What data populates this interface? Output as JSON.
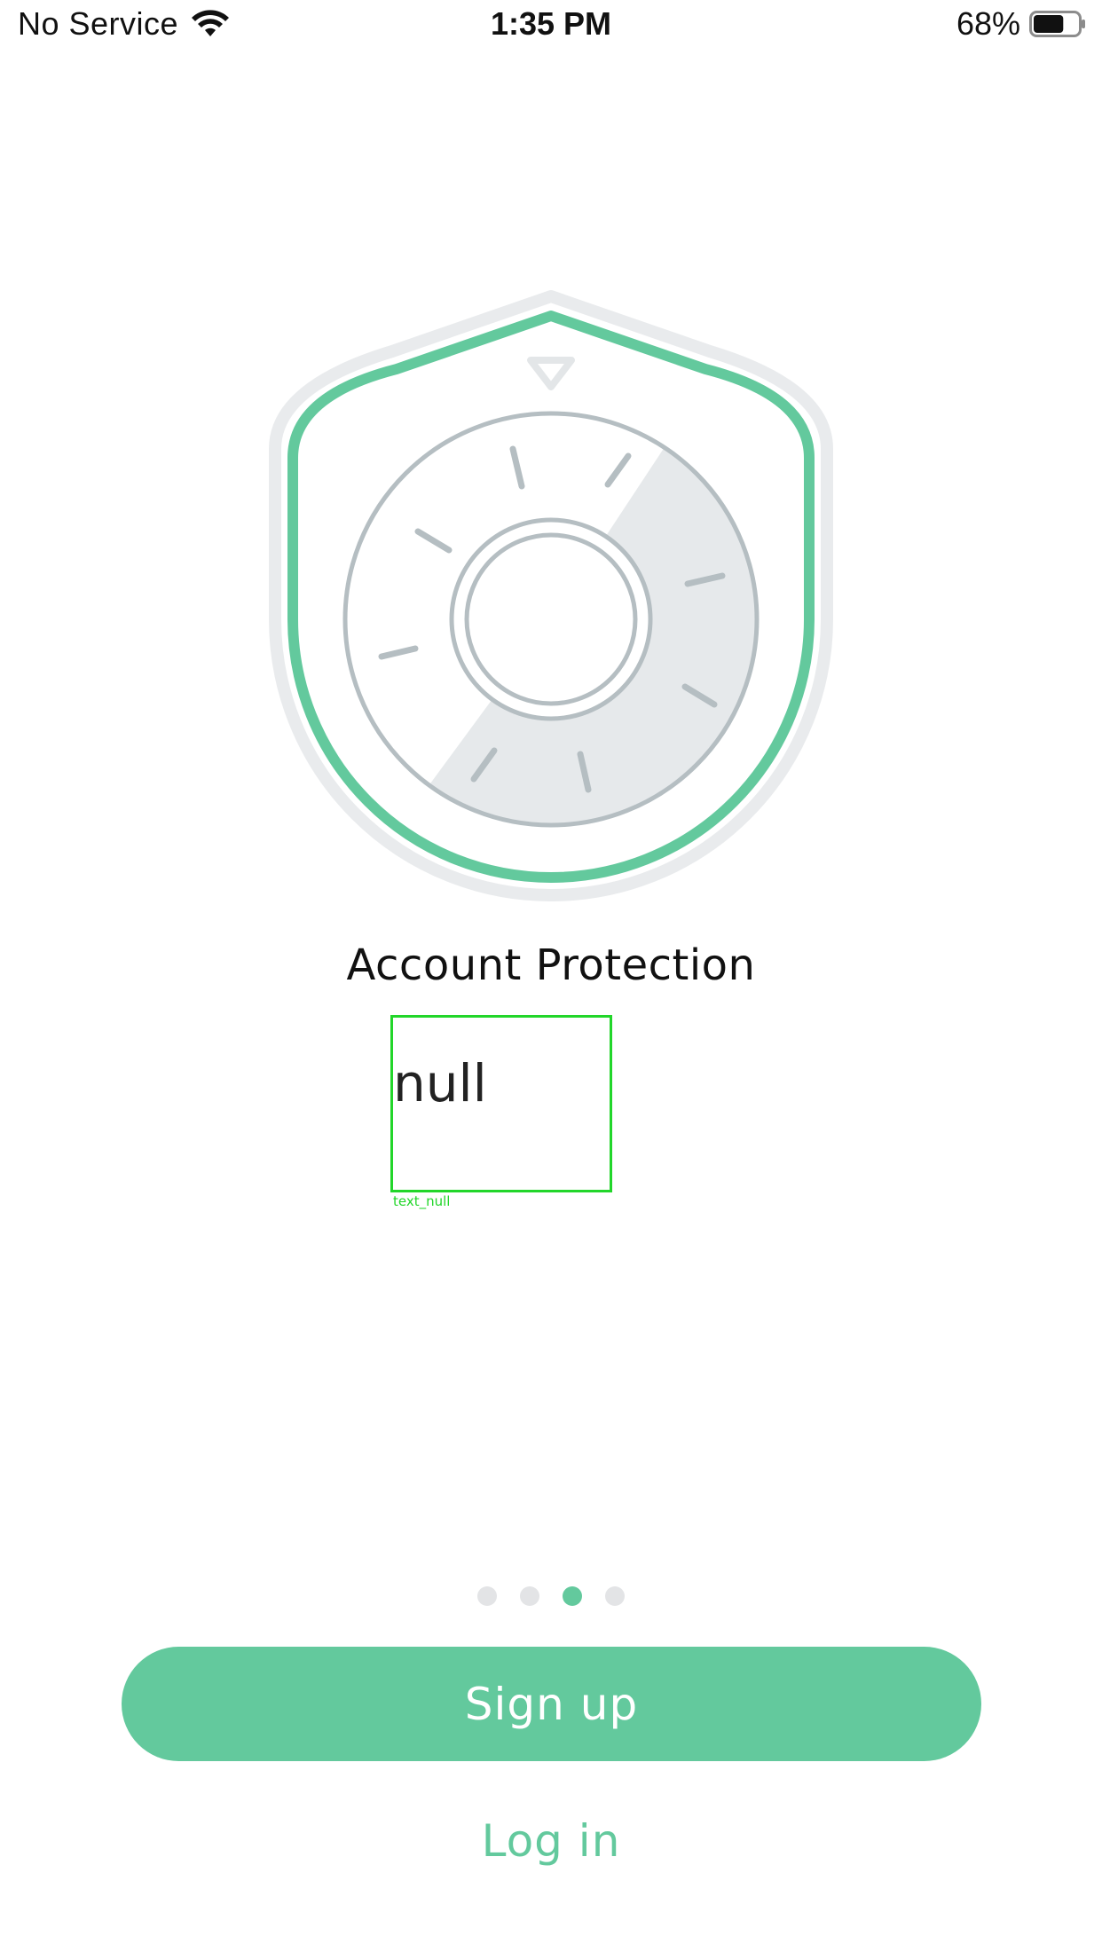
{
  "status_bar": {
    "carrier": "No Service",
    "time": "1:35 PM",
    "battery_percent": "68%",
    "battery_level": 0.68,
    "icons": [
      "wifi-icon",
      "battery-icon"
    ]
  },
  "onboarding": {
    "illustration": "shield-safe-dial-icon",
    "title": "Account Protection",
    "subtitle": "null",
    "subtitle_overlay_caption": "text_null",
    "page_count": 4,
    "active_page_index": 2
  },
  "actions": {
    "signup_label": "Sign up",
    "login_label": "Log in"
  },
  "colors": {
    "accent": "#63c99d",
    "dot_inactive": "#e3e4e6",
    "overlay_green": "#22d62a",
    "dial_gray": "#b5bec2",
    "shield_outer": "#e9ebed"
  }
}
